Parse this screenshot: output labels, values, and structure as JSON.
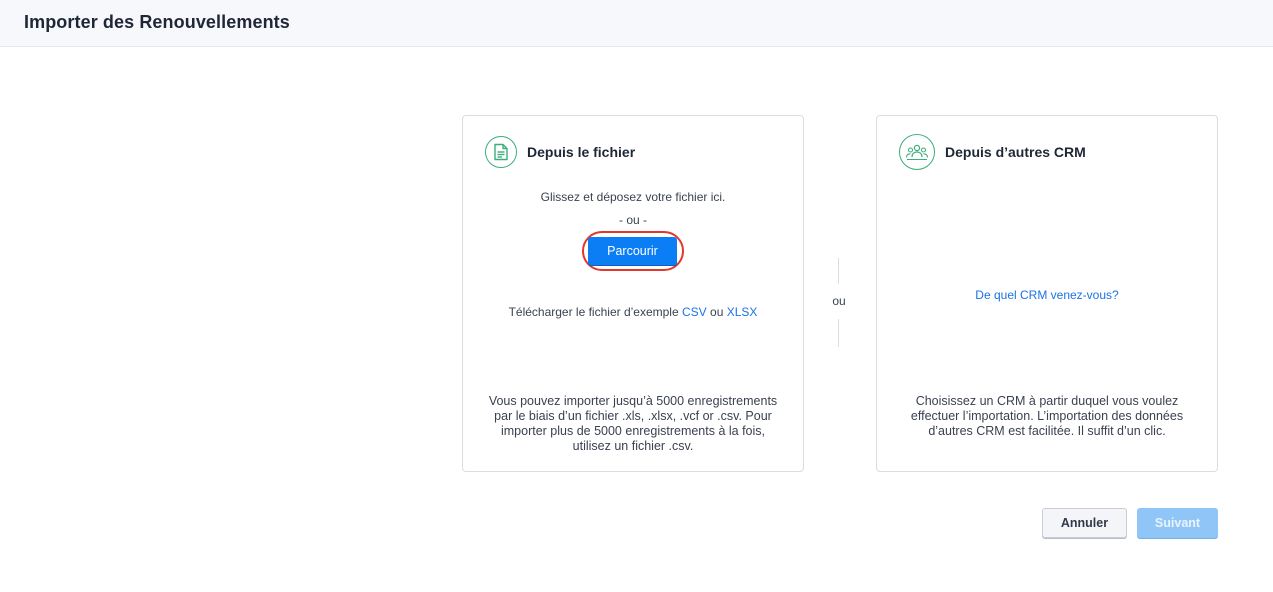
{
  "header": {
    "title": "Importer des Renouvellements"
  },
  "file_card": {
    "title": "Depuis le fichier",
    "icon": "document-icon",
    "drop_text": "Glissez et déposez votre fichier ici.",
    "or_text": "- ou -",
    "browse_label": "Parcourir",
    "sample_prefix": "Télécharger le fichier d’exemple",
    "sample_csv": "CSV",
    "sample_or": "ou",
    "sample_xlsx": "XLSX",
    "note": "Vous pouvez importer jusqu’à 5000 enregistrements par le biais d’un fichier .xls, .xlsx, .vcf or .csv. Pour importer plus de 5000 enregistrements à la fois, utilisez un fichier .csv."
  },
  "divider": {
    "or_text": "ou"
  },
  "crm_card": {
    "title": "Depuis d’autres CRM",
    "icon": "users-group-icon",
    "question_link": "De quel CRM venez-vous?",
    "note": "Choisissez un CRM à partir duquel vous voulez effectuer l’importation. L’importation des données d’autres CRM est facilitée. Il suffit d’un clic."
  },
  "footer": {
    "cancel_label": "Annuler",
    "next_label": "Suivant"
  },
  "colors": {
    "accent": "#0c7ef5",
    "icon_green": "#3cae7a",
    "highlight_ring": "#e0382d",
    "disabled_button": "#8fc6f7"
  }
}
